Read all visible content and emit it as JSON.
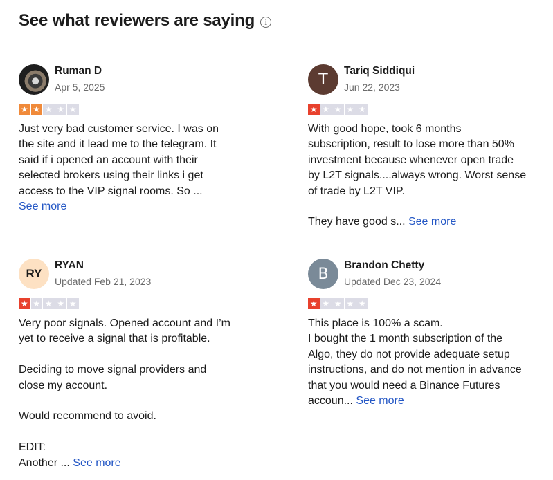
{
  "header": {
    "title": "See what reviewers are saying",
    "info_icon": "info-icon"
  },
  "colors": {
    "star_empty": "#dcdce6",
    "star_two": "#f08a3a",
    "star_one": "#e8412d",
    "link": "#2457c5"
  },
  "reviews": [
    {
      "name": "Ruman D",
      "date": "Apr 5, 2025",
      "rating": 2,
      "avatar": {
        "type": "photo"
      },
      "lines": [
        "Just very bad customer service. I was on",
        "the site and it lead me to the telegram. It",
        "said if i opened an account with their",
        "selected brokers using their links i get",
        "access to the VIP signal rooms. So ..."
      ],
      "see_more": "See more"
    },
    {
      "name": "Tariq Siddiqui",
      "date": "Jun 22, 2023",
      "rating": 1,
      "avatar": {
        "type": "letter",
        "text": "T",
        "bg": "#5c3b31"
      },
      "lines": [
        "With good hope, took 6 months",
        "subscription, result to lose more than 50%",
        "investment because whenever open trade",
        "by L2T signals....always wrong. Worst sense",
        "of trade by L2T VIP.",
        "",
        "They have good s..."
      ],
      "see_more": "See more"
    },
    {
      "name": "RYAN",
      "date": "Updated Feb 21, 2023",
      "rating": 1,
      "avatar": {
        "type": "initials",
        "text": "RY",
        "bg": "#fde1c3"
      },
      "lines": [
        "Very poor signals. Opened account and I’m",
        "yet to receive a signal that is profitable.",
        "",
        "Deciding to move signal providers and",
        "close my account.",
        "",
        "Would recommend to avoid.",
        "",
        "EDIT:",
        "Another ..."
      ],
      "see_more": "See more"
    },
    {
      "name": "Brandon Chetty",
      "date": "Updated Dec 23, 2024",
      "rating": 1,
      "avatar": {
        "type": "letter",
        "text": "B",
        "bg": "#7a8a98"
      },
      "lines": [
        "This place is 100% a scam.",
        "I bought the 1 month subscription of the",
        "Algo, they do not provide adequate setup",
        "instructions, and do not mention in advance",
        "that you would need a Binance Futures",
        "accoun..."
      ],
      "see_more": "See more"
    }
  ]
}
